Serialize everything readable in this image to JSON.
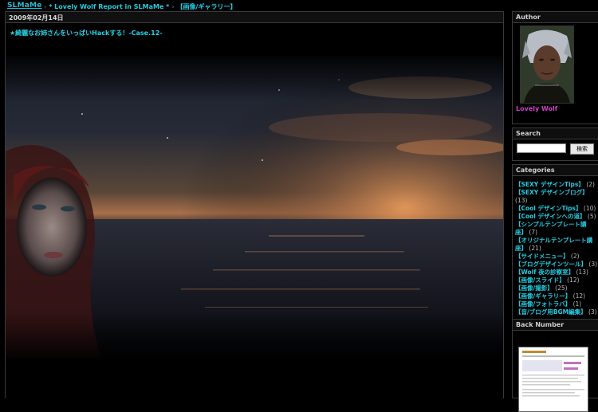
{
  "header": {
    "logo": "SLMaMe",
    "breadcrumbs": [
      {
        "sep": "›",
        "label": "* Lovely Wolf Report in SLMaMe *"
      },
      {
        "sep": "›",
        "label": "【画像/ギャラリー】"
      }
    ]
  },
  "post": {
    "date": "2009年02月14日",
    "title": "★綺麗なお姉さんをいっぱいHackする！-Case.12-"
  },
  "sidebar": {
    "author": {
      "heading": "Author",
      "name": "Lovely Wolf"
    },
    "search": {
      "heading": "Search",
      "button": "検索",
      "value": ""
    },
    "categories": {
      "heading": "Categories",
      "items": [
        {
          "label": "【SEXY デザインTips】",
          "count": "(2)"
        },
        {
          "label": "【SEXY デザインブログ】",
          "count": "(13)"
        },
        {
          "label": "【Cool デザインTips】",
          "count": "(10)"
        },
        {
          "label": "【Cool デザインへの道】",
          "count": "(5)"
        },
        {
          "label": "【シンプルテンプレート講座】",
          "count": "(7)"
        },
        {
          "label": "【オリジナルテンプレート講座】",
          "count": "(21)"
        },
        {
          "label": "【サイドメニュー】",
          "count": "(2)"
        },
        {
          "label": "【ブログデザインツール】",
          "count": "(3)"
        },
        {
          "label": "【Wolf 夜の診察室】",
          "count": "(13)"
        },
        {
          "label": "【画像/スライド】",
          "count": "(12)"
        },
        {
          "label": "【画像/撮影】",
          "count": "(25)"
        },
        {
          "label": "【画像/ギャラリー】",
          "count": "(12)"
        },
        {
          "label": "【画像/フォトラバ】",
          "count": "(1)"
        },
        {
          "label": "【音/ブログ用BGM編集】",
          "count": "(3)"
        }
      ]
    },
    "backnumber": {
      "heading": "Back Number"
    }
  },
  "colors": {
    "link": "#22cce0",
    "author": "#d040c8",
    "border": "#3a3a3a",
    "background": "#000000"
  }
}
